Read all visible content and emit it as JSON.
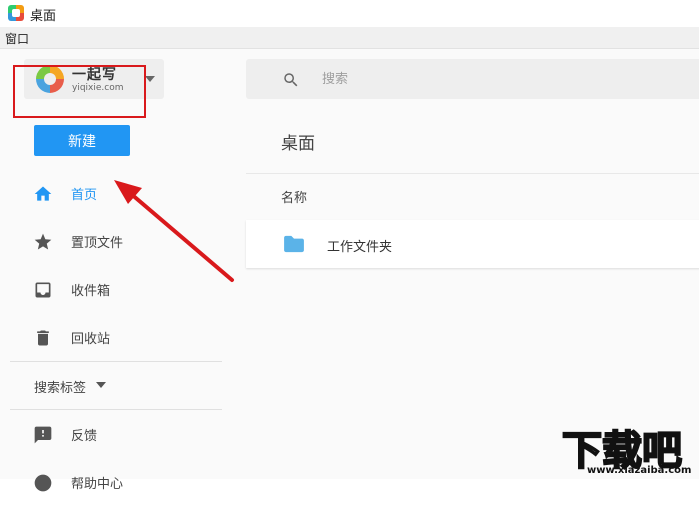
{
  "window": {
    "title": "桌面"
  },
  "menu": {
    "items": [
      "窗口"
    ]
  },
  "logo": {
    "name": "一起写",
    "url": "yiqixie.com"
  },
  "new_button": {
    "label": "新建"
  },
  "nav": {
    "home": "首页",
    "pinned": "置顶文件",
    "inbox": "收件箱",
    "trash": "回收站",
    "search_tags": "搜索标签",
    "feedback": "反馈",
    "help": "帮助中心"
  },
  "search": {
    "placeholder": "搜索"
  },
  "main": {
    "title": "桌面",
    "column_header": "名称",
    "items": [
      {
        "name": "工作文件夹",
        "icon": "folder-icon"
      }
    ]
  },
  "watermark": {
    "big": "下载吧",
    "small": "www.xiazaiba.com"
  },
  "colors": {
    "accent": "#2196f3",
    "highlight": "#d9191c",
    "folder": "#5bb3e8"
  }
}
